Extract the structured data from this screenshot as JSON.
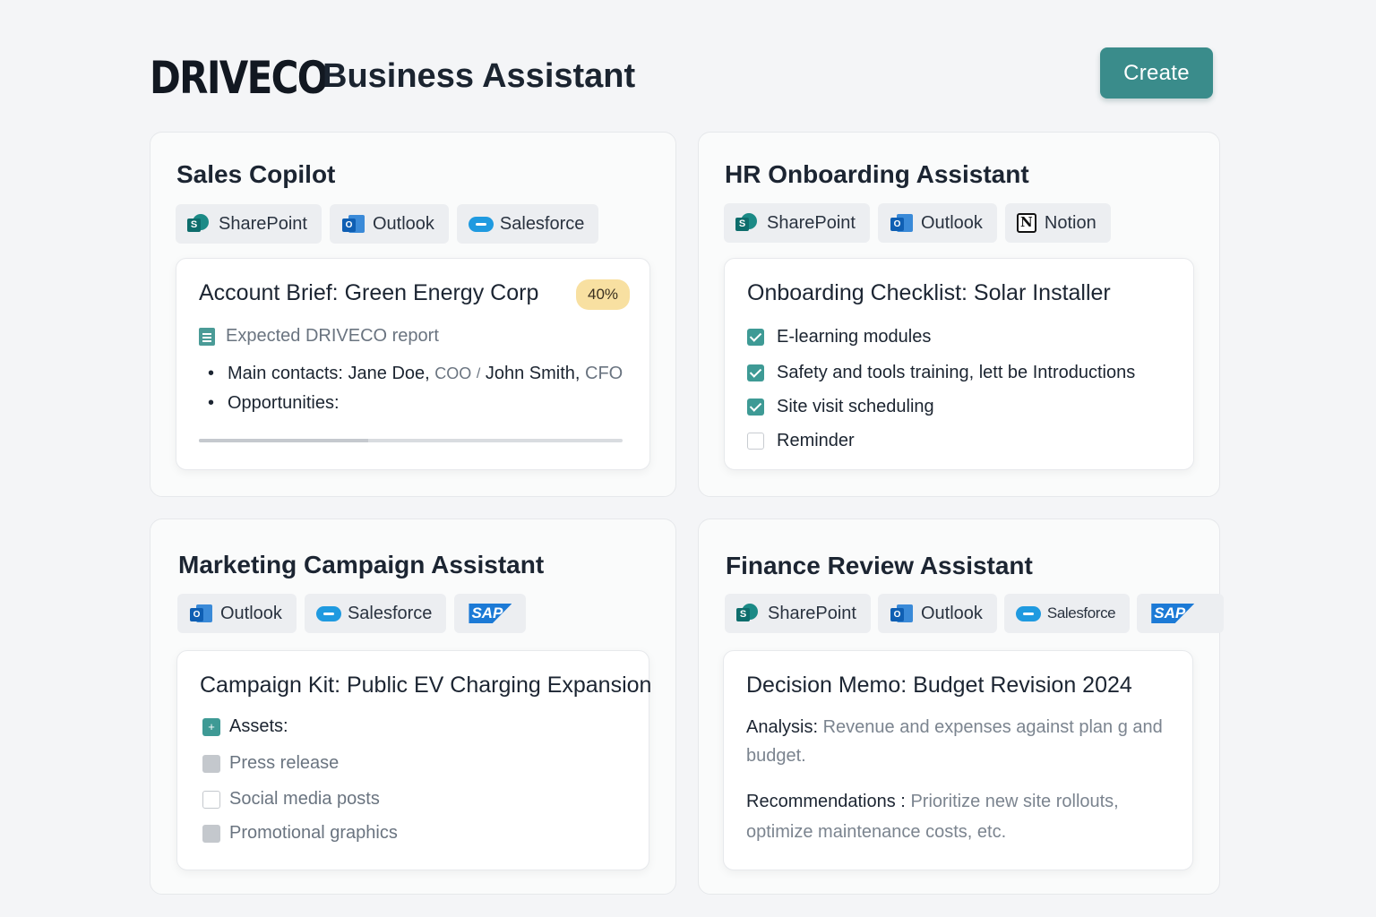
{
  "header": {
    "brand": "DRIVECO",
    "title": "Business Assistant",
    "create_label": "Create"
  },
  "sales": {
    "title": "Sales Copilot",
    "chips": [
      "SharePoint",
      "Outlook",
      "Salesforce"
    ],
    "doc_title": "Account Brief: Green Energy Corp",
    "progress_label": "40%",
    "progress": 0.4,
    "subtitle": "Expected DRIVECO report",
    "contacts_label": "Main contacts:",
    "contact_1": "Jane Doe,",
    "contact_1_role": "COO",
    "separator": "/",
    "contact_2": "John Smith,",
    "contact_2_role": "CFO",
    "opportunities_label": "Opportunities:"
  },
  "hr": {
    "title": "HR Onboarding Assistant",
    "chips": [
      "SharePoint",
      "Outlook",
      "Notion"
    ],
    "doc_title": "Onboarding Checklist: Solar Installer",
    "checklist": [
      {
        "label": "E-learning modules",
        "checked": true
      },
      {
        "label": "Safety and tools training, lett be Introductions",
        "checked": true
      },
      {
        "label": "Site visit scheduling",
        "checked": true
      },
      {
        "label": "Reminder",
        "checked": false
      }
    ]
  },
  "marketing": {
    "title": "Marketing Campaign Assistant",
    "chips": [
      "Outlook",
      "Salesforce",
      "SAP"
    ],
    "doc_title": "Campaign Kit: Public EV Charging Expansion",
    "assets_label": "Assets:",
    "assets": [
      "Press release",
      "Social media posts",
      "Promotional graphics"
    ]
  },
  "finance": {
    "title": "Finance Review Assistant",
    "chips": [
      "SharePoint",
      "Outlook",
      "Salesforce",
      "SAP"
    ],
    "doc_title": "Decision Memo: Budget Revision 2024",
    "analysis_label": "Analysis:",
    "analysis_text": "Revenue and expenses against plan g and budget.",
    "recommendations_label": "Recommendations :",
    "recommendations_text": "Prioritize new site rollouts, optimize maintenance costs, etc."
  },
  "colors": {
    "accent": "#3a8c8b",
    "badge": "#f8e0a1",
    "check": "#3e9a95"
  }
}
